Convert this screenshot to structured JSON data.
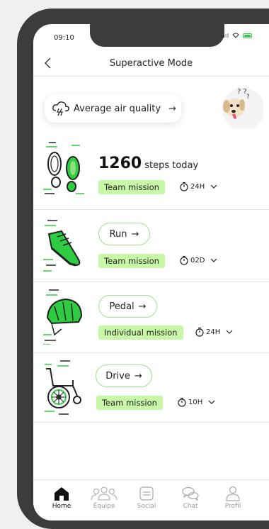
{
  "status": {
    "time": "09:10"
  },
  "header": {
    "title": "Superactive Mode"
  },
  "air_quality": {
    "label": "Average air quality",
    "arrow": "→"
  },
  "steps": {
    "count": "1260",
    "label": "steps today",
    "tag": "Team mission",
    "timer": "24H"
  },
  "activities": [
    {
      "label": "Run",
      "arrow": "→",
      "tag": "Team mission",
      "timer": "02D"
    },
    {
      "label": "Pedal",
      "arrow": "→",
      "tag": "Individual mission",
      "timer": "24H"
    },
    {
      "label": "Drive",
      "arrow": "→",
      "tag": "Team mission",
      "timer": "10H"
    }
  ],
  "tabs": [
    {
      "label": "Home",
      "icon": "home-icon",
      "active": true
    },
    {
      "label": "Équipe",
      "icon": "team-icon"
    },
    {
      "label": "Social",
      "icon": "social-icon"
    },
    {
      "label": "Chat",
      "icon": "chat-icon"
    },
    {
      "label": "Profil",
      "icon": "profile-icon"
    }
  ],
  "colors": {
    "accent": "#2ecc40",
    "tag_bg": "#c8f7a8",
    "frame": "#3c3c3c"
  }
}
